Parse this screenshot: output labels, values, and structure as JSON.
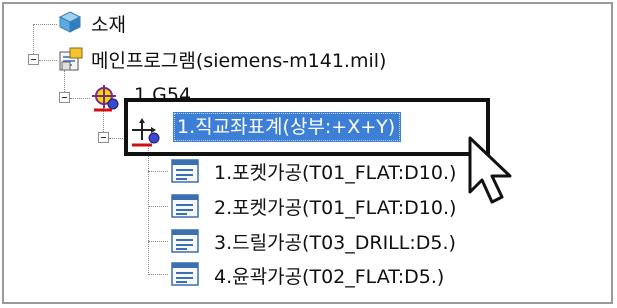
{
  "tree": {
    "root": {
      "label": "소재"
    },
    "program": {
      "label": "메인프로그램(siemens-m141.mil)"
    },
    "origin": {
      "label": "1.G54"
    },
    "coord": {
      "label": "1.직교좌표계(상부:+X+Y)"
    },
    "ops": [
      {
        "label": "1.포켓가공(T01_FLAT:D10.)"
      },
      {
        "label": "2.포켓가공(T01_FLAT:D10.)"
      },
      {
        "label": "3.드릴가공(T03_DRILL:D5.)"
      },
      {
        "label": "4.윤곽가공(T02_FLAT:D5.)"
      }
    ]
  },
  "colors": {
    "selection": "#3d7fd6",
    "highlight_border": "#111111"
  },
  "icons": {
    "root": "cube-icon",
    "program": "program-icon",
    "origin": "origin-target-icon",
    "coord": "coordinate-system-icon",
    "op": "toolpath-icon",
    "cursor": "mouse-pointer-icon"
  }
}
